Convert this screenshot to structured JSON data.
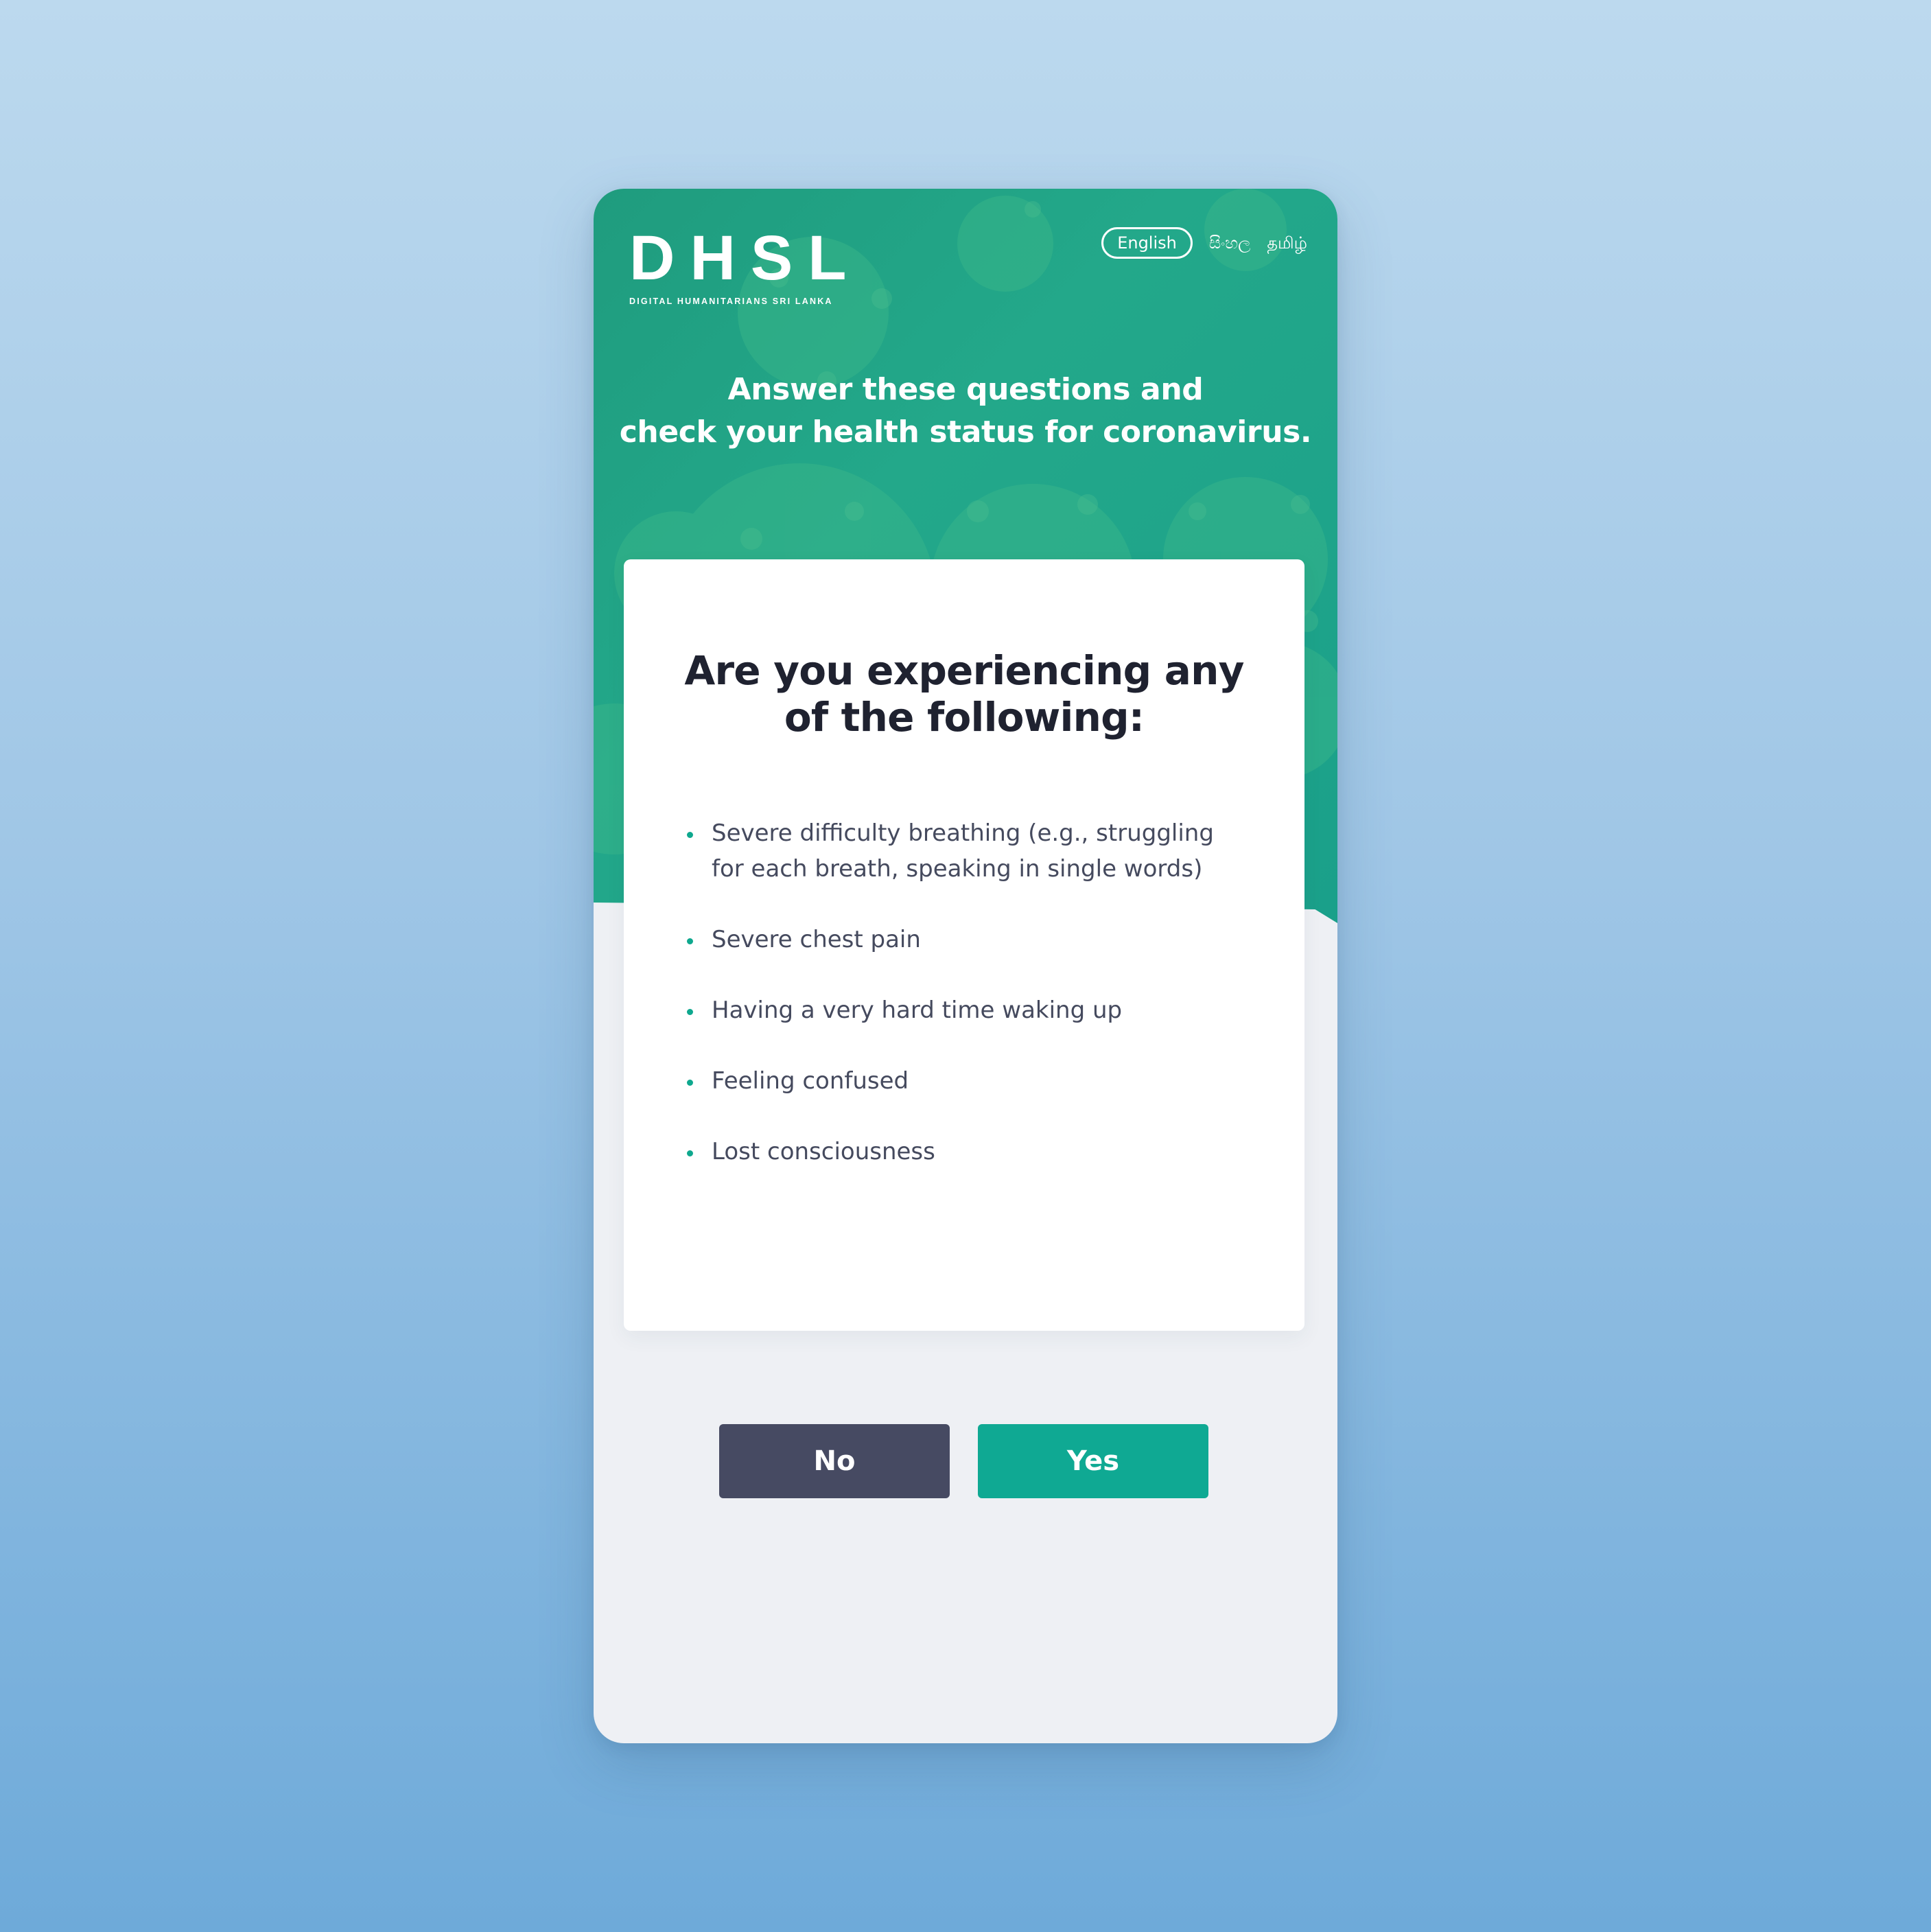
{
  "brand": {
    "logo_text": "DHSL",
    "logo_subtitle": "DIGITAL HUMANITARIANS SRI LANKA"
  },
  "languages": [
    {
      "label": "English",
      "active": true
    },
    {
      "label": "සිංහල",
      "active": false
    },
    {
      "label": "தமிழ்",
      "active": false
    }
  ],
  "header": {
    "headline_line1": "Answer these questions and",
    "headline_line2": "check your health status for coronavirus."
  },
  "question": {
    "title_line1": "Are you experiencing any",
    "title_line2": "of the following:",
    "items": [
      "Severe difficulty breathing (e.g., struggling for each breath, speaking in single words)",
      "Severe chest pain",
      "Having a very hard time waking up",
      "Feeling confused",
      "Lost consciousness"
    ]
  },
  "actions": {
    "no_label": "No",
    "yes_label": "Yes"
  },
  "colors": {
    "accent": "#0fa993",
    "hero": "#1f9c7e",
    "secondary_button": "#464a62",
    "panel_background": "#eef0f4",
    "text_dark": "#1f2230",
    "text_body": "#454a5e"
  },
  "icons": {
    "background_decoration": "coronavirus-particles"
  }
}
